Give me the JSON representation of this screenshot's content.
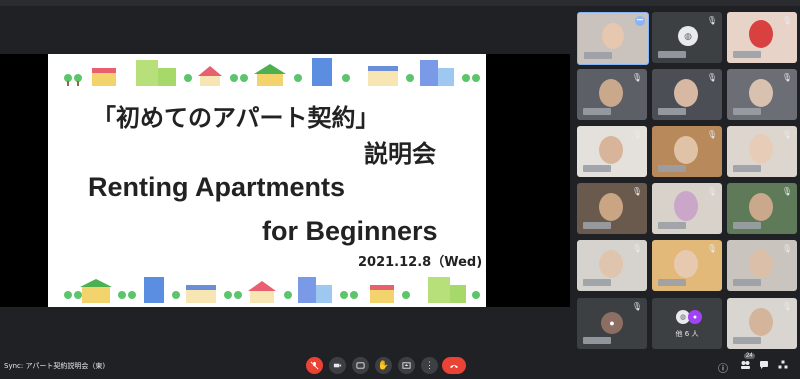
{
  "slide": {
    "title_jp_line1": "「初めてのアパート契約」",
    "title_jp_line2": "説明会",
    "title_en_line1": "Renting Apartments",
    "title_en_line2": "for Beginners",
    "date": "2021.12.8（Wed)"
  },
  "participants": {
    "others_label": "他 6 人",
    "count_badge": "24"
  },
  "meeting": {
    "title": "Sync: アパート契約説明会（東)"
  },
  "icons": {
    "mic": "mic-off-icon",
    "camera": "camera-icon",
    "captions": "captions-icon",
    "hand": "raise-hand-icon",
    "present": "present-icon",
    "more": "more-options-icon",
    "end": "end-call-icon",
    "info": "info-icon",
    "people": "people-icon",
    "chat": "chat-icon",
    "activities": "activities-icon"
  },
  "colors": {
    "end_call": "#ea4335",
    "background": "#202124",
    "control": "#3c4043"
  }
}
